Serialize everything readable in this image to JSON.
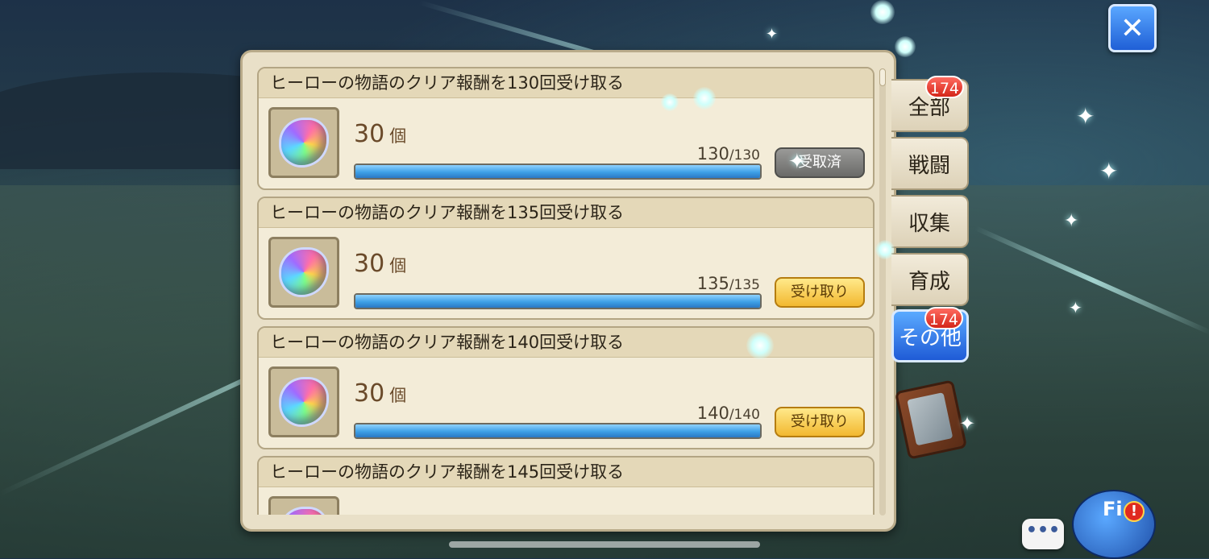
{
  "close_button": {
    "icon": "close-x-icon",
    "glyph": "✕"
  },
  "missions": [
    {
      "title": "ヒーローの物語のクリア報酬を130回受け取る",
      "reward_icon": "rainbow-gem-icon",
      "reward_amount": "30",
      "reward_unit": "個",
      "progress_current": "130",
      "progress_total": "130",
      "progress_fraction": 1.0,
      "button_label": "受取済",
      "button_state": "claimed"
    },
    {
      "title": "ヒーローの物語のクリア報酬を135回受け取る",
      "reward_icon": "rainbow-gem-icon",
      "reward_amount": "30",
      "reward_unit": "個",
      "progress_current": "135",
      "progress_total": "135",
      "progress_fraction": 1.0,
      "button_label": "受け取り",
      "button_state": "available"
    },
    {
      "title": "ヒーローの物語のクリア報酬を140回受け取る",
      "reward_icon": "rainbow-gem-icon",
      "reward_amount": "30",
      "reward_unit": "個",
      "progress_current": "140",
      "progress_total": "140",
      "progress_fraction": 1.0,
      "button_label": "受け取り",
      "button_state": "available"
    },
    {
      "title": "ヒーローの物語のクリア報酬を145回受け取る",
      "reward_icon": "rainbow-gem-icon"
    }
  ],
  "tabs": [
    {
      "label": "全部",
      "badge": "174",
      "selected": false
    },
    {
      "label": "戦闘",
      "badge": "",
      "selected": false
    },
    {
      "label": "収集",
      "badge": "",
      "selected": false
    },
    {
      "label": "育成",
      "badge": "",
      "selected": false
    },
    {
      "label": "その他",
      "badge": "174",
      "selected": true
    }
  ],
  "side_icons": {
    "book": "mission-book-icon"
  },
  "bottom": {
    "chat_glyph": "•••",
    "field_label": "Fi",
    "alert_glyph": "!"
  },
  "colors": {
    "accent_blue": "#1f5fd6",
    "badge_red": "#d4261a",
    "progress_blue": "#3ea0e6",
    "claim_gold": "#f2b830",
    "panel_cream": "#e9e0c8"
  }
}
